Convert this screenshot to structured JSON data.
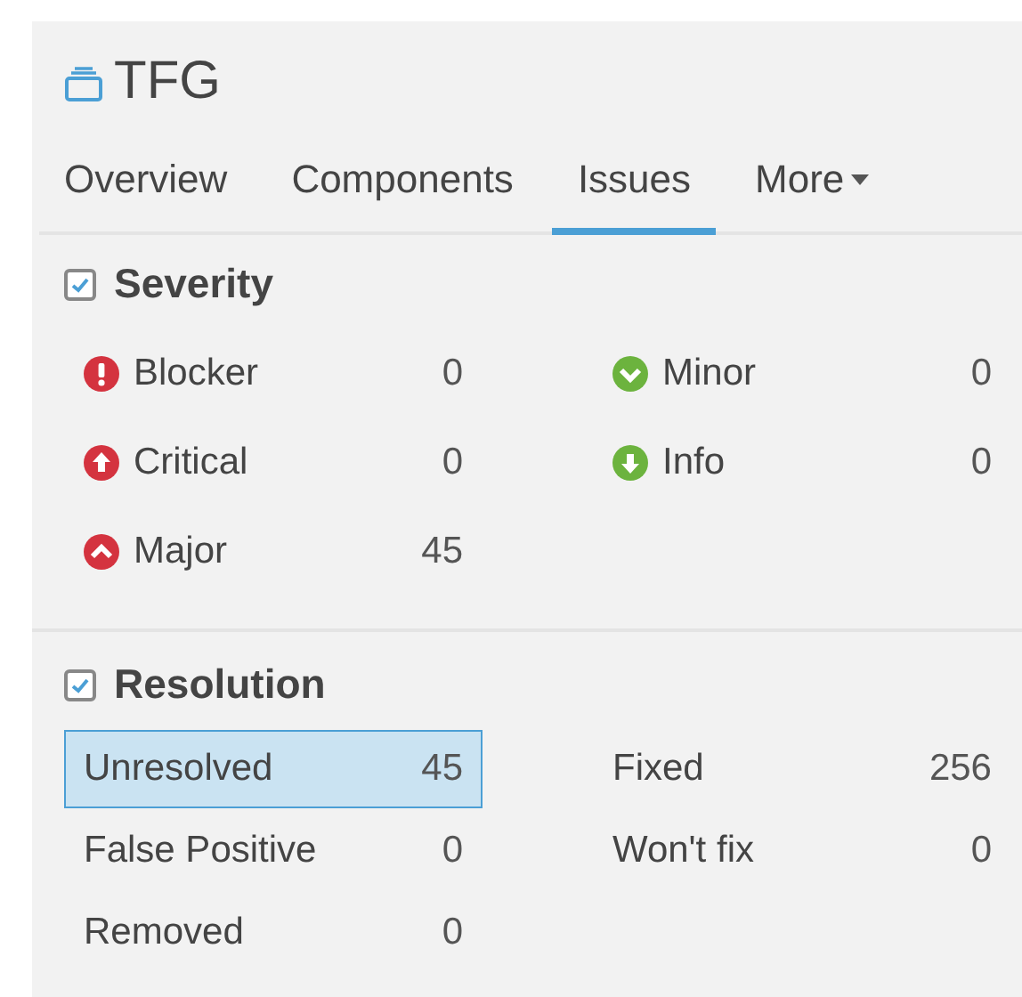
{
  "project": {
    "title": "TFG"
  },
  "tabs": [
    {
      "label": "Overview",
      "selected": false
    },
    {
      "label": "Components",
      "selected": false
    },
    {
      "label": "Issues",
      "selected": true
    },
    {
      "label": "More",
      "selected": false,
      "dropdown": true
    }
  ],
  "facets": [
    {
      "title": "Severity",
      "checked": true,
      "items": [
        {
          "kind": "blocker",
          "label": "Blocker",
          "count": "0",
          "selected": false
        },
        {
          "kind": "minor",
          "label": "Minor",
          "count": "0",
          "selected": false
        },
        {
          "kind": "critical",
          "label": "Critical",
          "count": "0",
          "selected": false
        },
        {
          "kind": "info",
          "label": "Info",
          "count": "0",
          "selected": false
        },
        {
          "kind": "major",
          "label": "Major",
          "count": "45",
          "selected": false
        }
      ]
    },
    {
      "title": "Resolution",
      "checked": true,
      "items": [
        {
          "label": "Unresolved",
          "count": "45",
          "selected": true
        },
        {
          "label": "Fixed",
          "count": "256",
          "selected": false
        },
        {
          "label": "False Positive",
          "count": "0",
          "selected": false
        },
        {
          "label": "Won't fix",
          "count": "0",
          "selected": false
        },
        {
          "label": "Removed",
          "count": "0",
          "selected": false
        }
      ]
    }
  ]
}
